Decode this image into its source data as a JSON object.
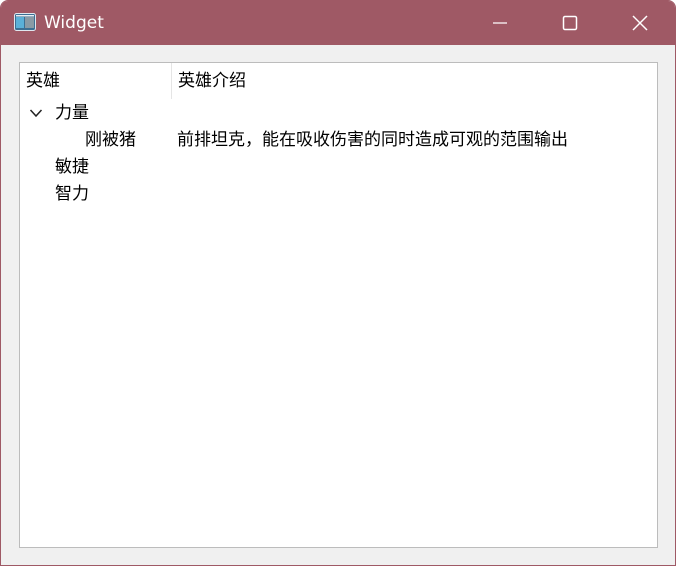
{
  "window": {
    "title": "Widget",
    "app_icon": "widget-app-icon",
    "controls": {
      "minimize_icon": "minimize-icon",
      "maximize_icon": "maximize-icon",
      "close_icon": "close-icon"
    },
    "accent": "#9f5965"
  },
  "tree": {
    "headers": [
      "英雄",
      "英雄介绍"
    ],
    "rows": [
      {
        "name": "力量",
        "desc": "",
        "level": 0,
        "expanded": true
      },
      {
        "name": "刚被猪",
        "desc": "前排坦克，能在吸收伤害的同时造成可观的范围输出",
        "level": 1
      },
      {
        "name": "敏捷",
        "desc": "",
        "level": 0
      },
      {
        "name": "智力",
        "desc": "",
        "level": 0
      }
    ]
  }
}
